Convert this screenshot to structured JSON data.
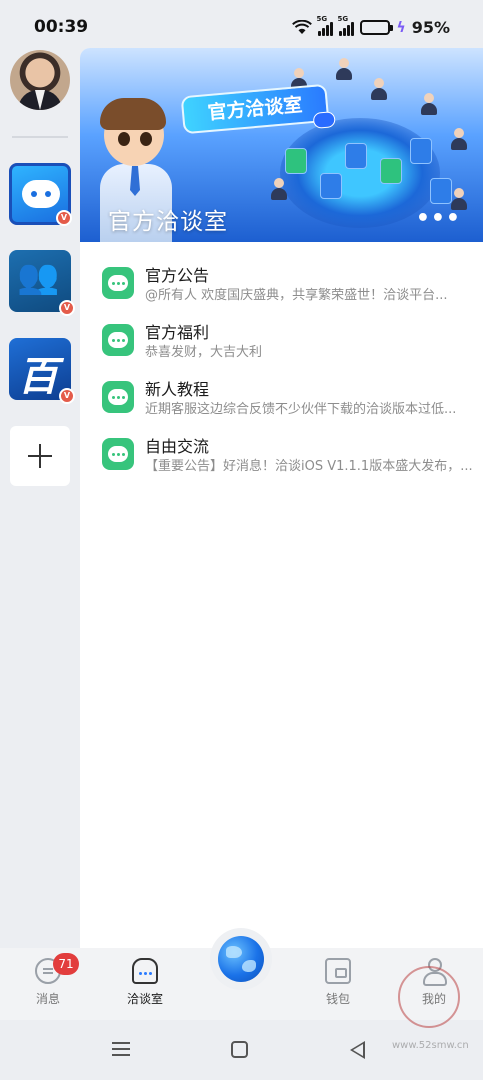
{
  "status_bar": {
    "time": "00:39",
    "signal_1": "5G",
    "signal_2": "5G",
    "battery_level": 0.95,
    "battery": "95%"
  },
  "sidebar": {
    "avatar_name": "user-avatar",
    "apps": [
      {
        "name": "chat-bubble-app",
        "verified": "V"
      },
      {
        "name": "group-app",
        "verified": "V"
      },
      {
        "name": "bai-app",
        "label": "百",
        "verified": "V"
      }
    ],
    "add_label": "+"
  },
  "banner": {
    "sign_text": "官方洽谈室",
    "title": "官方洽谈室",
    "more": "•••"
  },
  "channels": [
    {
      "name": "官方公告",
      "preview": "@所有人 欢度国庆盛典，共享繁荣盛世！洽谈平台..."
    },
    {
      "name": "官方福利",
      "preview": "恭喜发财，大吉大利"
    },
    {
      "name": "新人教程",
      "preview": "近期客服这边综合反馈不少伙伴下载的洽谈版本过低..."
    },
    {
      "name": "自由交流",
      "preview": "【重要公告】好消息！洽谈iOS V1.1.1版本盛大发布，..."
    }
  ],
  "bottom_nav": {
    "messages": {
      "label": "消息",
      "badge": "71"
    },
    "room": {
      "label": "洽谈室"
    },
    "wallet": {
      "label": "钱包"
    },
    "me": {
      "label": "我的"
    }
  },
  "watermark": {
    "seal": "吾爱首码",
    "url": "www.52smw.cn"
  },
  "colors": {
    "accent": "#2a7bff",
    "channel_icon": "#37c47c",
    "badge": "#e23d3d",
    "battery": "#7b5cf5"
  }
}
